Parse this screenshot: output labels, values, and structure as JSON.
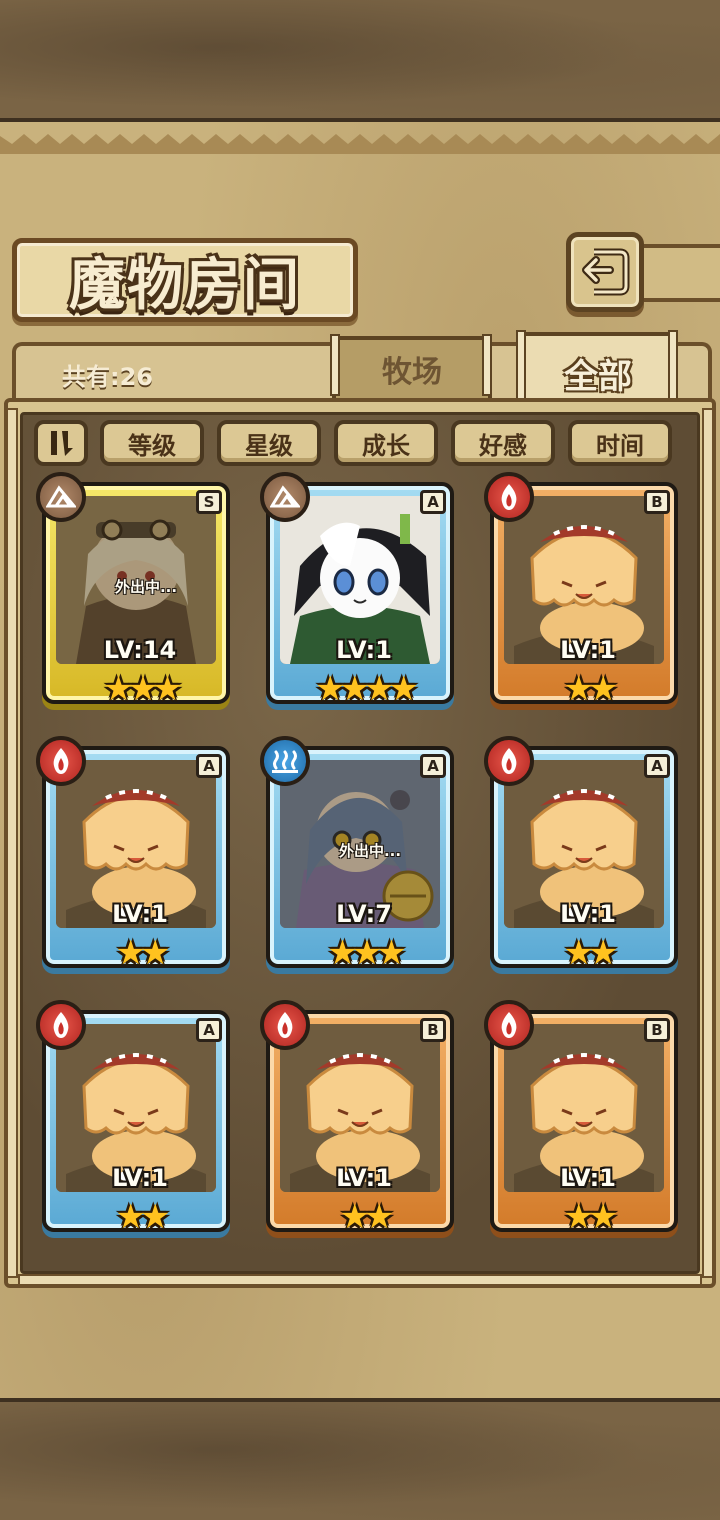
{
  "title": "魔物房间",
  "count_label": "共有:26",
  "tabs": [
    {
      "label": "牧场",
      "active": false
    },
    {
      "label": "全部",
      "active": true
    }
  ],
  "sort_buttons": [
    "等级",
    "星级",
    "成长",
    "好感",
    "时间"
  ],
  "away_label": "外出中...",
  "colors": {
    "rank_S": "#e7cc3a",
    "rank_A": "#6fb8de",
    "rank_B": "#e1923f",
    "element_fire": "#c9302a",
    "element_earth": "#8b6a50",
    "element_water": "#2a84c8"
  },
  "monsters": [
    {
      "grade": "S",
      "element": "earth",
      "level": "LV:14",
      "stars": 3,
      "away": true,
      "portrait": "goggles-girl"
    },
    {
      "grade": "A",
      "element": "earth",
      "level": "LV:1",
      "stars": 4,
      "away": false,
      "portrait": "panda-girl"
    },
    {
      "grade": "B",
      "element": "fire",
      "level": "LV:1",
      "stars": 2,
      "away": false,
      "portrait": "pudding-slime"
    },
    {
      "grade": "A",
      "element": "fire",
      "level": "LV:1",
      "stars": 2,
      "away": false,
      "portrait": "pudding-slime"
    },
    {
      "grade": "A",
      "element": "water",
      "level": "LV:7",
      "stars": 3,
      "away": true,
      "portrait": "bell-cat-girl"
    },
    {
      "grade": "A",
      "element": "fire",
      "level": "LV:1",
      "stars": 2,
      "away": false,
      "portrait": "pudding-slime"
    },
    {
      "grade": "A",
      "element": "fire",
      "level": "LV:1",
      "stars": 2,
      "away": false,
      "portrait": "pudding-slime"
    },
    {
      "grade": "B",
      "element": "fire",
      "level": "LV:1",
      "stars": 2,
      "away": false,
      "portrait": "pudding-slime"
    },
    {
      "grade": "B",
      "element": "fire",
      "level": "LV:1",
      "stars": 2,
      "away": false,
      "portrait": "pudding-slime"
    }
  ]
}
